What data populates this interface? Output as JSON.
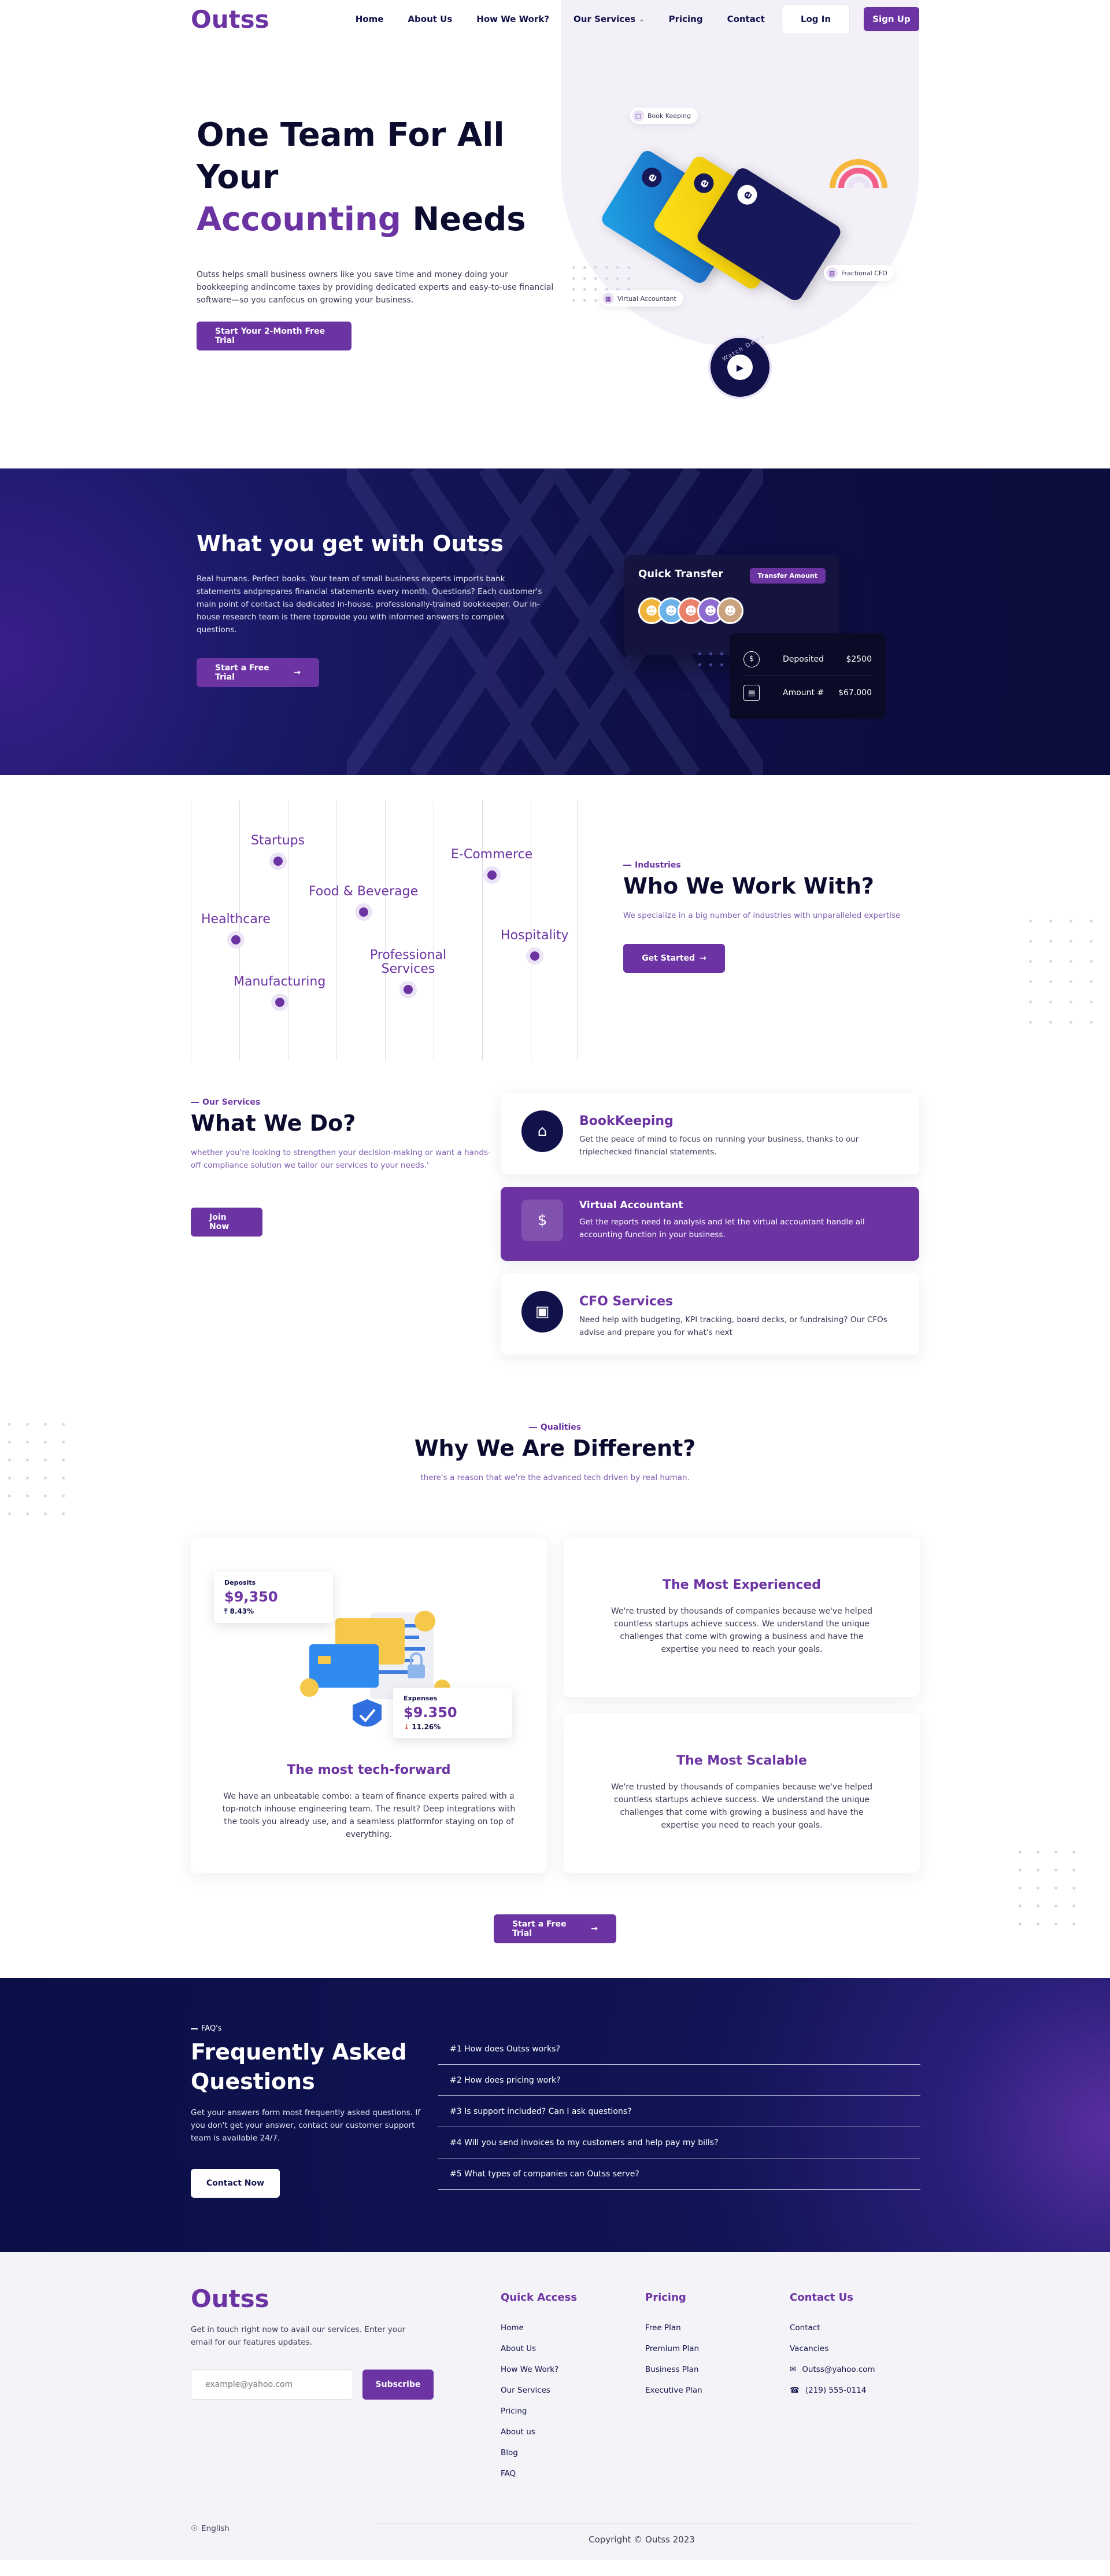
{
  "nav": {
    "logo": "Outss",
    "links": [
      "Home",
      "About Us",
      "How We Work?",
      "Our Services",
      "Pricing",
      "Contact"
    ],
    "login": "Log In",
    "signup": "Sign Up"
  },
  "hero": {
    "title_line1": "One Team For All Your",
    "title_accent": "Accounting",
    "title_rest": "Needs",
    "description": "Outss helps small business owners like you save time and money doing your bookkeeping andincome taxes by providing dedicated experts and easy-to-use financial software—so you canfocus on growing your business.",
    "cta": "Start Your 2-Month Free Trial",
    "tags": [
      "Book Keeping",
      "Virtual Accountant",
      "Fractional CFO"
    ],
    "badge_text": "Watch Demo"
  },
  "what": {
    "title": "What you get with Outss",
    "description": "Real humans. Perfect books. Your team of small business experts imports bank statements andprepares financial statements every month. Questions? Each customer's main point of contact isa dedicated in-house, professionally-trained bookkeeper. Our in-house research team is there toprovide you with informed answers to complex questions.",
    "cta": "Start a Free Trial",
    "quick_transfer": "Quick Transfer",
    "transfer_amount": "Transfer Amount",
    "deposited_label": "Deposited",
    "deposited_value": "$2500",
    "amount_label": "Amount #",
    "amount_value": "$67.000"
  },
  "industries": {
    "eyebrow": "Industries",
    "title": "Who We Work With?",
    "subtitle": "We specialize in a big number of industries with unparalleled expertise",
    "cta": "Get Started",
    "items": [
      "Startups",
      "E-Commerce",
      "Food & Beverage",
      "Healthcare",
      "Hospitality",
      "Professional Services",
      "Manufacturing"
    ]
  },
  "services": {
    "eyebrow": "Our Services",
    "title": "What We Do?",
    "subtitle": "whether you're looking to strengthen your decision-making or want a hands-off compliance solution we tailor our services to your needs.'",
    "cta": "Join Now",
    "items": [
      {
        "name": "BookKeeping",
        "desc": "Get the peace of mind to focus on running your business, thanks to our triplechecked financial statements.",
        "icon": "house-dollar-icon"
      },
      {
        "name": "Virtual Accountant",
        "desc": "Get the reports need to analysis and let the virtual accountant handle all accounting function in your business.",
        "icon": "clipboard-dollar-icon"
      },
      {
        "name": "CFO Services",
        "desc": "Need help with budgeting, KPI tracking, board decks, or fundraising? Our CFOs advise and prepare you for what's next",
        "icon": "money-icon"
      }
    ]
  },
  "qualities": {
    "eyebrow": "Qualities",
    "title": "Why We Are Different?",
    "subtitle": "there's a reason that we're the advanced tech driven by real human.",
    "deposits_label": "Deposits",
    "deposits_value": "$9,350",
    "deposits_change": "8.43%",
    "expenses_label": "Expenses",
    "expenses_value": "$9.350",
    "expenses_change": "11.26%",
    "left": {
      "title": "The most tech-forward",
      "desc": "We have an unbeatable combo: a team of finance experts paired with a top-notch inhouse engineering team. The result? Deep integrations with the tools you already use, and a seamless platformfor staying on top of everything."
    },
    "right": [
      {
        "title": "The Most Experienced",
        "desc": "We're trusted by thousands of companies because we've helped countless startups achieve success. We understand the unique challenges that come with growing a business and have the expertise you need to reach your goals."
      },
      {
        "title": "The Most Scalable",
        "desc": "We're trusted by thousands of companies because we've helped countless startups achieve success. We understand the unique challenges that come with growing a business and have the expertise you need to reach your goals."
      }
    ],
    "cta": "Start a Free Trial"
  },
  "faq": {
    "eyebrow": "FAQ's",
    "title": "Frequently Asked Questions",
    "description": "Get your answers form most frequently asked questions. If you don't get your answer, contact our customer support team is available 24/7.",
    "cta": "Contact Now",
    "items": [
      "#1 How does Outss works?",
      "#2 How does pricing work?",
      "#3 Is support included? Can I ask questions?",
      "#4 Will you send invoices to my customers and help pay my bills?",
      "#5 What types of companies can Outss serve?"
    ]
  },
  "footer": {
    "logo": "Outss",
    "description": "Get in touch right now to avail our services. Enter your email for our features updates.",
    "email_placeholder": "example@yahoo.com",
    "subscribe": "Subscribe",
    "quick_access_title": "Quick Access",
    "quick_access": [
      "Home",
      "About Us",
      "How We Work?",
      "Our Services",
      "Pricing",
      "About us",
      "Blog",
      "FAQ"
    ],
    "pricing_title": "Pricing",
    "pricing": [
      "Free Plan",
      "Premium Plan",
      "Business Plan",
      "Executive Plan"
    ],
    "contact_title": "Contact Us",
    "contact": [
      "Contact",
      "Vacancies",
      "Outss@yahoo.com",
      "(219) 555-0114"
    ],
    "language": "English",
    "copyright": "Copyright © Outss 2023"
  }
}
